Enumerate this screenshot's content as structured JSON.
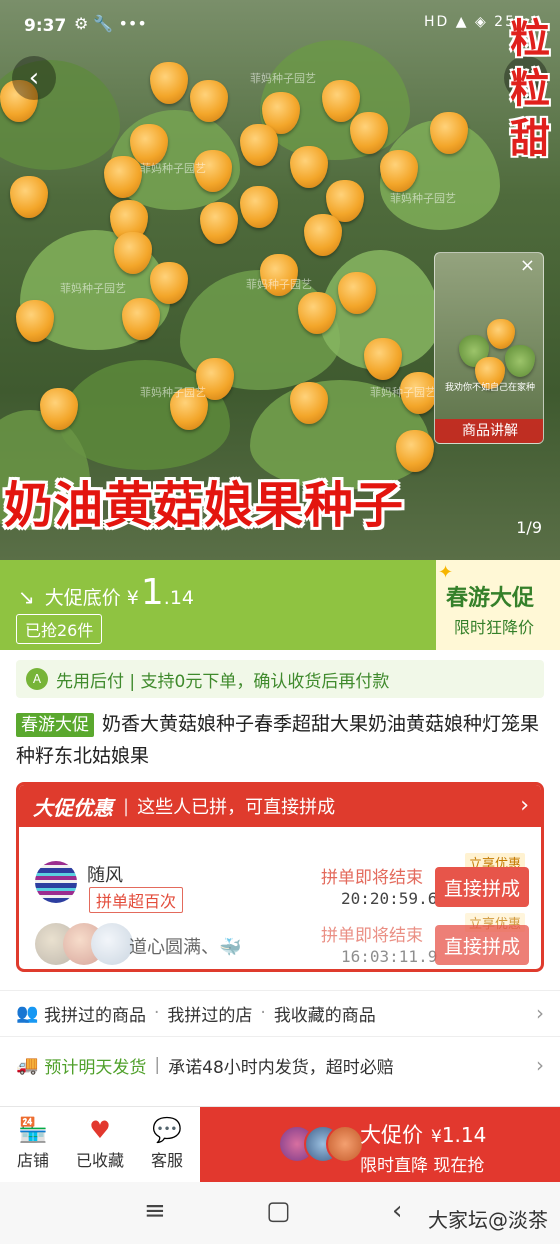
{
  "status_bar": {
    "time": "9:37",
    "icons": "⚙ 🔧 •••",
    "right": "HD ▲ ◈ 25"
  },
  "hero": {
    "side_title": [
      "粒",
      "粒",
      "甜"
    ],
    "watermark": "菲妈种子园艺",
    "title": "奶油黄菇娘果种子",
    "page_indicator": "1/9",
    "video_card": {
      "subtitle": "我劝你不如自己在家种",
      "label": "商品讲解"
    }
  },
  "price_bar": {
    "label": "大促底价",
    "currency": "¥",
    "price_int": "1",
    "price_dec": ".14",
    "grabbed": "已抢26件",
    "promo_title": "春游大促",
    "promo_sub": "限时狂降价"
  },
  "pay_line": {
    "icon_text": "A",
    "text": "先用后付 | 支持0元下单，确认收货后再付款"
  },
  "product": {
    "tag": "春游大促",
    "title": "奶香大黄菇娘种子春季超甜大果奶油黄菇娘种灯笼果种籽东北姑娘果"
  },
  "group": {
    "logo": "大促优惠",
    "header": "这些人已拼，可直接拼成",
    "rows": [
      {
        "name": "随风",
        "badge": "拼单超百次",
        "ending": "拼单即将结束",
        "timer": "20:20:59.6",
        "enjoy": "立享优惠",
        "button": "直接拼成"
      },
      {
        "name": "道心圆满、🐳",
        "ending": "拼单即将结束",
        "timer": "16:03:11.9",
        "enjoy": "立享优惠",
        "button": "直接拼成"
      }
    ]
  },
  "links": {
    "item1": "我拼过的商品",
    "item2": "我拼过的店",
    "item3": "我收藏的商品"
  },
  "delivery": {
    "highlight": "预计明天发货",
    "text": "承诺48小时内发货，超时必赔"
  },
  "bottom_bar": {
    "store": "店铺",
    "favorite": "已收藏",
    "service": "客服",
    "buy_label": "大促价",
    "buy_currency": "¥",
    "buy_price": "1.14",
    "buy_sub": "限时直降 现在抢"
  },
  "nav": {
    "credit": "大家坛@淡茶"
  },
  "colors": {
    "accent_red": "#e2382e",
    "accent_green": "#8fc341",
    "promo_green": "#35802a"
  }
}
